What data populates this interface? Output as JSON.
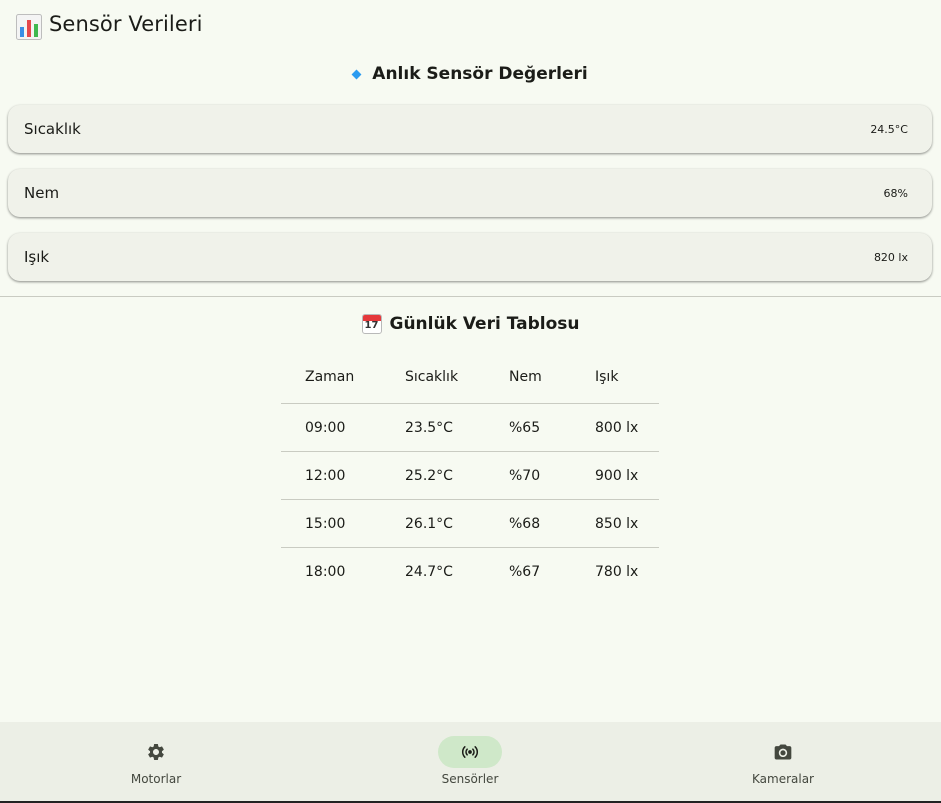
{
  "app": {
    "title": "Sensör Verileri"
  },
  "instant": {
    "heading": "Anlık Sensör Değerleri",
    "sensors": [
      {
        "label": "Sıcaklık",
        "value": "24.5°C"
      },
      {
        "label": "Nem",
        "value": "68%"
      },
      {
        "label": "Işık",
        "value": "820 lx"
      }
    ]
  },
  "daily": {
    "heading": "Günlük Veri Tablosu",
    "calendar_day": "17",
    "columns": [
      "Zaman",
      "Sıcaklık",
      "Nem",
      "Işık"
    ],
    "rows": [
      [
        "09:00",
        "23.5°C",
        "%65",
        "800 lx"
      ],
      [
        "12:00",
        "25.2°C",
        "%70",
        "900 lx"
      ],
      [
        "15:00",
        "26.1°C",
        "%68",
        "850 lx"
      ],
      [
        "18:00",
        "24.7°C",
        "%67",
        "780 lx"
      ]
    ]
  },
  "nav": {
    "items": [
      {
        "label": "Motorlar",
        "icon": "gear-icon",
        "active": false
      },
      {
        "label": "Sensörler",
        "icon": "sensors-icon",
        "active": true
      },
      {
        "label": "Kameralar",
        "icon": "camera-icon",
        "active": false
      }
    ],
    "active_color": "#cfe8c9"
  }
}
